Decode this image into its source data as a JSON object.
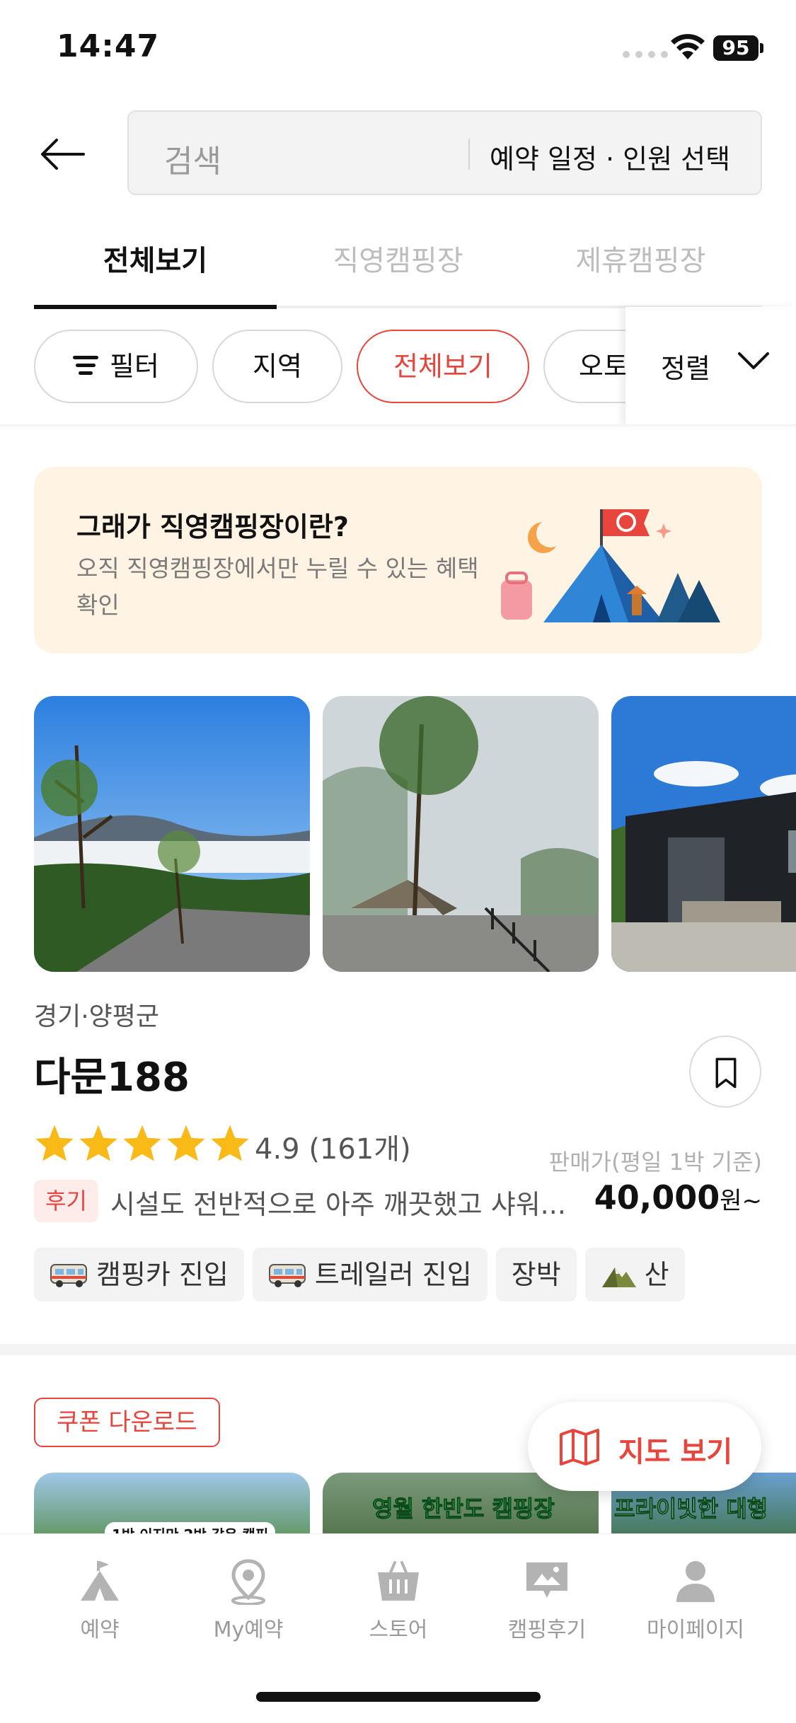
{
  "status_bar": {
    "time": "14:47",
    "battery": "95"
  },
  "header": {
    "search_placeholder": "검색",
    "date_people": "예약 일정 · 인원 선택"
  },
  "tabs": [
    {
      "label": "전체보기",
      "active": true
    },
    {
      "label": "직영캠핑장",
      "active": false
    },
    {
      "label": "제휴캠핑장",
      "active": false
    }
  ],
  "chips": {
    "filter": "필터",
    "region": "지역",
    "all": "전체보기",
    "auto": "오토",
    "sort": "정렬"
  },
  "banner": {
    "title": "그래가 직영캠핑장이란?",
    "description": "오직 직영캠핑장에서만 누릴 수 있는 혜택 확인"
  },
  "listing": {
    "region": "경기·양평군",
    "name": "다문188",
    "stars": 5,
    "rating": "4.9 (161개)",
    "price_basis": "판매가(평일 1박 기준)",
    "review_badge": "후기",
    "review_text": "시설도 전반적으로 아주 깨끗했고 샤워...",
    "price": "40,000",
    "price_unit": "원~",
    "tags": [
      "캠핑카 진입",
      "트레일러 진입",
      "장박",
      "산"
    ]
  },
  "listing2": {
    "coupon": "쿠폰 다운로드",
    "photo_captions": [
      "1박 이지만 2박 같은 캠핑",
      "영월 한반도 캠핑장",
      "프라이빗한 대형"
    ]
  },
  "map_button": {
    "label": "지도 보기"
  },
  "bottom_nav": [
    {
      "label": "예약",
      "icon": "tent-icon"
    },
    {
      "label": "My예약",
      "icon": "location-pin-icon"
    },
    {
      "label": "스토어",
      "icon": "shopping-basket-icon"
    },
    {
      "label": "캠핑후기",
      "icon": "review-image-icon"
    },
    {
      "label": "마이페이지",
      "icon": "person-icon"
    }
  ],
  "colors": {
    "accent": "#e8453c",
    "banner_bg": "#fff4e4",
    "star": "#f9b916"
  }
}
